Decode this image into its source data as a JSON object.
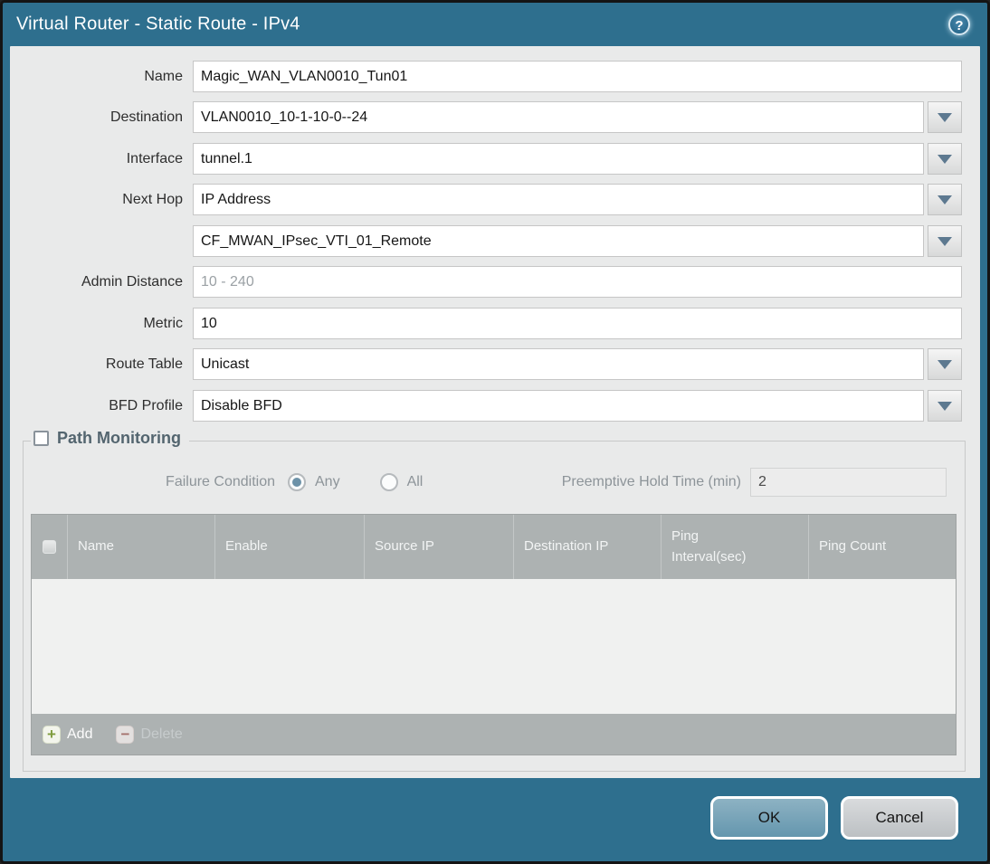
{
  "dialog": {
    "title": "Virtual Router - Static Route - IPv4"
  },
  "icons": {
    "help": "?",
    "add": "+",
    "delete": "−"
  },
  "form": {
    "name": {
      "label": "Name",
      "value": "Magic_WAN_VLAN0010_Tun01"
    },
    "destination": {
      "label": "Destination",
      "value": "VLAN0010_10-1-10-0--24"
    },
    "interface": {
      "label": "Interface",
      "value": "tunnel.1"
    },
    "next_hop": {
      "label": "Next Hop",
      "type_value": "IP Address",
      "address_value": "CF_MWAN_IPsec_VTI_01_Remote"
    },
    "admin_distance": {
      "label": "Admin Distance",
      "placeholder": "10 - 240",
      "value": ""
    },
    "metric": {
      "label": "Metric",
      "value": "10"
    },
    "route_table": {
      "label": "Route Table",
      "value": "Unicast"
    },
    "bfd_profile": {
      "label": "BFD Profile",
      "value": "Disable BFD"
    }
  },
  "path_monitoring": {
    "title": "Path Monitoring",
    "enabled": false,
    "failure_condition_label": "Failure Condition",
    "failure_options": [
      {
        "label": "Any",
        "selected": true
      },
      {
        "label": "All",
        "selected": false
      }
    ],
    "preemptive_hold_label": "Preemptive Hold Time (min)",
    "preemptive_hold_value": "2",
    "table": {
      "columns": [
        "Name",
        "Enable",
        "Source IP",
        "Destination IP",
        "Ping Interval(sec)",
        "Ping Count"
      ],
      "rows": []
    },
    "add_label": "Add",
    "delete_label": "Delete"
  },
  "actions": {
    "ok": "OK",
    "cancel": "Cancel"
  },
  "colors": {
    "frame_teal": "#2e6f8e",
    "content_bg": "#e9eaea",
    "table_header_bg": "#adb2b2",
    "ok_button_bg": "#6f9fb5",
    "radio_selected_fill": "#6d92a8",
    "add_icon_green": "#7e9b3c",
    "delete_icon_red": "#a2635c"
  }
}
